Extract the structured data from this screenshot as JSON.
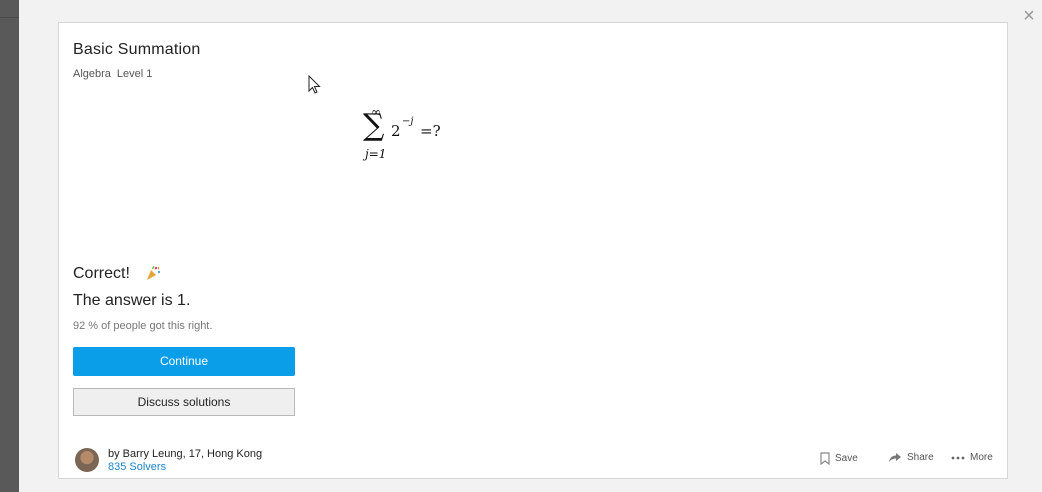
{
  "problem": {
    "title": "Basic Summation",
    "topic": "Algebra",
    "level": "Level 1",
    "formula": {
      "upper_limit": "∞",
      "sigma": "∑",
      "lower_limit": "j=1",
      "base": "2",
      "exponent": "−j",
      "rest": "=?"
    }
  },
  "result": {
    "heading": "Correct!",
    "answer_text": "The answer is 1.",
    "stat_text": "92 % of people got this right."
  },
  "buttons": {
    "continue": "Continue",
    "discuss": "Discuss solutions"
  },
  "footer": {
    "author": "by Barry Leung, 17, Hong Kong",
    "solvers": "835 Solvers",
    "save": "Save",
    "share": "Share",
    "more": "More"
  },
  "close_symbol": "×",
  "colors": {
    "accent": "#0a9ee8",
    "link": "#1a86c8"
  },
  "icons": [
    "close-icon",
    "party-popper-icon",
    "bookmark-icon",
    "share-arrow-icon",
    "more-dots-icon",
    "mouse-cursor-icon"
  ]
}
